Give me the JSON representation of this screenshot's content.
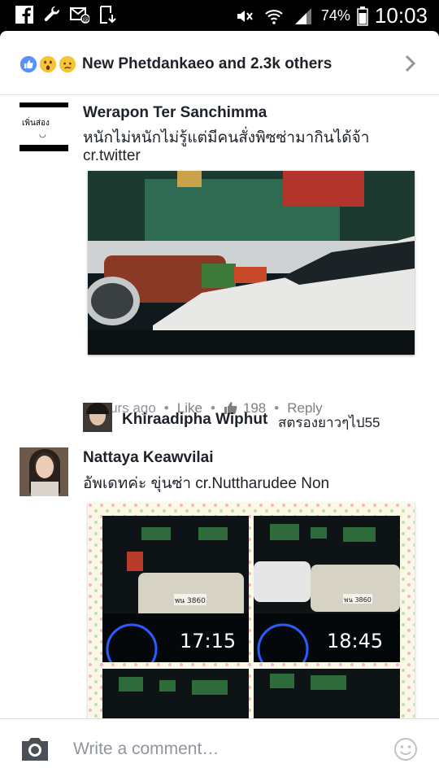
{
  "status_bar": {
    "battery": "74%",
    "time": "10:03",
    "left_icons": [
      "facebook-icon",
      "wrench-icon",
      "missed-mail-icon",
      "download-icon"
    ],
    "right_icons": [
      "mute-icon",
      "wifi-icon",
      "signal-icon",
      "battery-icon"
    ]
  },
  "reactions": {
    "icons": [
      "like-reaction-icon",
      "wow-reaction-icon",
      "sad-reaction-icon"
    ],
    "text": "New Phetdankaeo and 2.3k others"
  },
  "comments": [
    {
      "name": "Werapon Ter Sanchimma",
      "text_line1": "หนักไม่หนักไม่รู้แต่มีคนสั่งพิซซ่ามากินได้จ้า",
      "text_line2": "cr.twitter",
      "avatar_text": "เพิ่นส่อง",
      "meta": {
        "time": "8 hours ago",
        "like": "Like",
        "like_count": "198",
        "reply": "Reply"
      }
    },
    {
      "name": "Khiraadipha Wiphut",
      "text": "สตรองยาวๆไป55"
    },
    {
      "name": "Nattaya Keawvilai",
      "text": "อัพเดทค่ะ ขุ่นซ่า cr.Nuttharudee Non",
      "tiles": [
        {
          "time": "17:15"
        },
        {
          "time": "18:45"
        }
      ]
    }
  ],
  "composer": {
    "placeholder": "Write a comment…"
  },
  "colors": {
    "brand_blue": "#4267b2",
    "like_blue": "#5890ff",
    "text": "#1d2129",
    "muted": "#90949c"
  }
}
